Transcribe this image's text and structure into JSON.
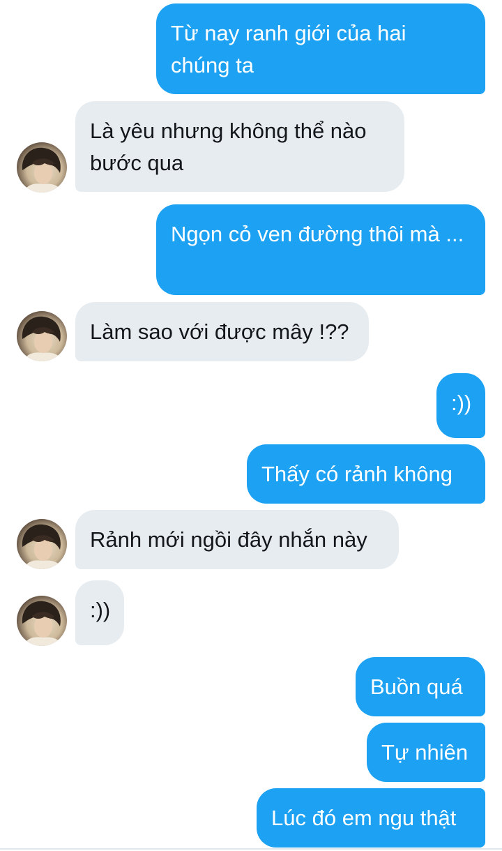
{
  "messages": [
    {
      "side": "out",
      "text": "Từ nay ranh giới của hai chúng ta"
    },
    {
      "side": "in",
      "text": "Là yêu nhưng không thể nào bước qua"
    },
    {
      "side": "out",
      "text": "Ngọn cỏ ven đường thôi mà ..."
    },
    {
      "side": "in",
      "text": "Làm sao với được mây !??"
    },
    {
      "side": "out",
      "text": ":))"
    },
    {
      "side": "out",
      "text": "Thấy có rảnh không"
    },
    {
      "side": "in",
      "text": "Rảnh mới ngồi đây nhắn này"
    },
    {
      "side": "in",
      "text": ":))"
    },
    {
      "side": "out",
      "text": "Buồn quá"
    },
    {
      "side": "out",
      "text": "Tự nhiên"
    },
    {
      "side": "out",
      "text": "Lúc đó em ngu thật"
    }
  ],
  "colors": {
    "outgoing_bubble": "#1da1f2",
    "incoming_bubble": "#e7ecf0",
    "incoming_text": "#14171a",
    "outgoing_text": "#ffffff"
  },
  "avatar_icon": "user-avatar-photo"
}
